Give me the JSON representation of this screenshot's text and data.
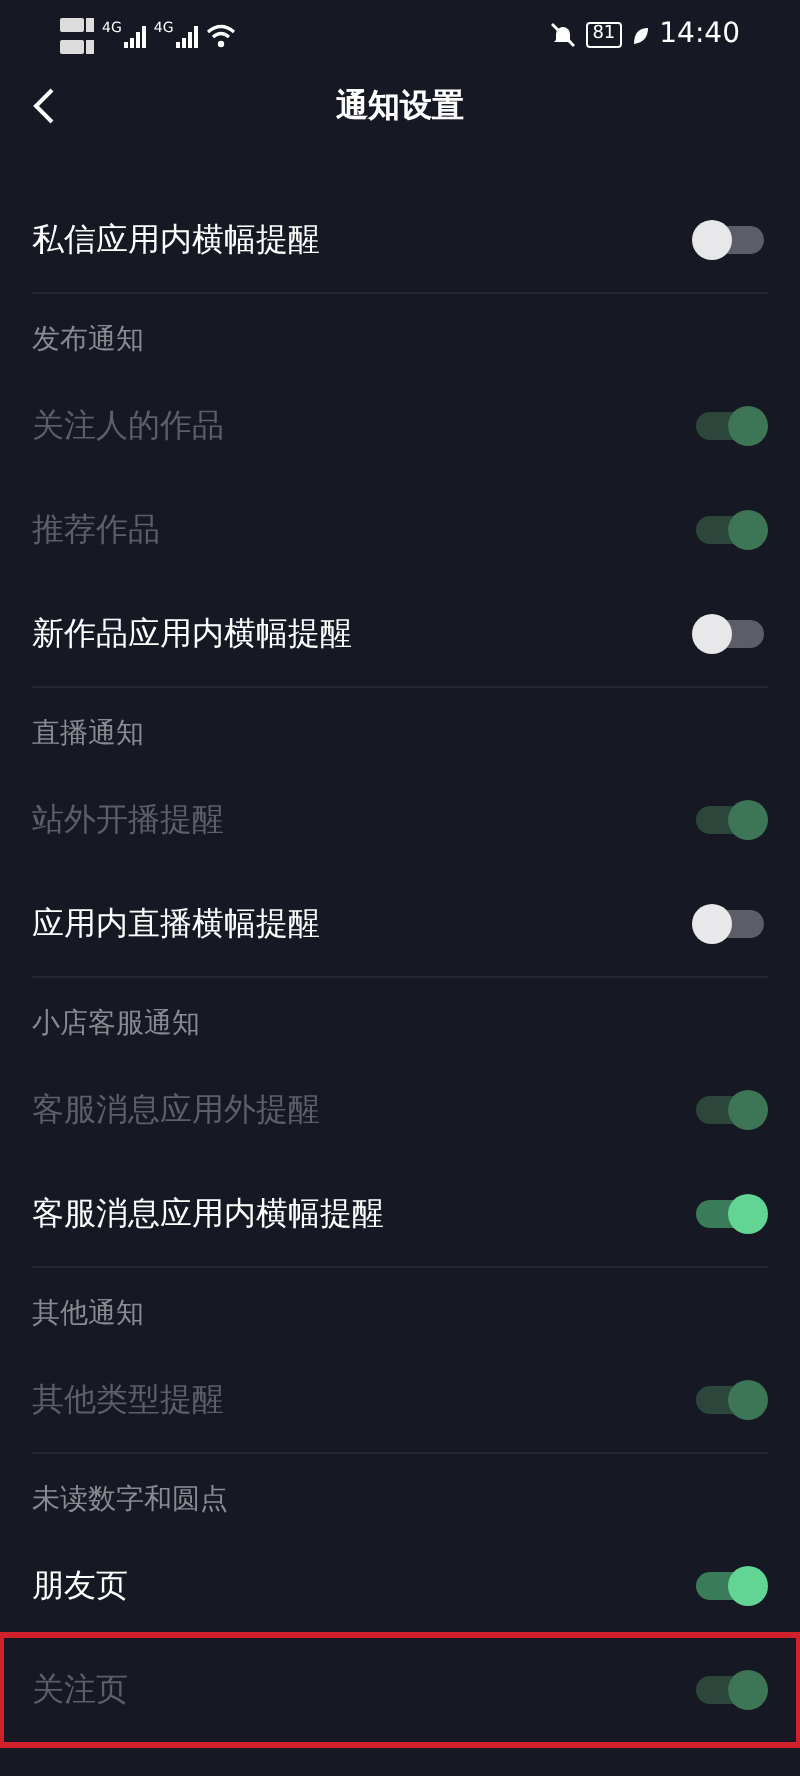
{
  "status_bar": {
    "network_1": "4G",
    "network_2": "4G",
    "battery": "81",
    "time": "14:40"
  },
  "header": {
    "title": "通知设置"
  },
  "groups": [
    {
      "items": [
        {
          "label": "私信应用内横幅提醒",
          "on": false,
          "disabled": false,
          "highlighted": false
        }
      ]
    },
    {
      "title": "发布通知",
      "items": [
        {
          "label": "关注人的作品",
          "on": true,
          "disabled": true,
          "highlighted": false
        },
        {
          "label": "推荐作品",
          "on": true,
          "disabled": true,
          "highlighted": false
        },
        {
          "label": "新作品应用内横幅提醒",
          "on": false,
          "disabled": false,
          "highlighted": false
        }
      ]
    },
    {
      "title": "直播通知",
      "items": [
        {
          "label": "站外开播提醒",
          "on": true,
          "disabled": true,
          "highlighted": false
        },
        {
          "label": "应用内直播横幅提醒",
          "on": false,
          "disabled": false,
          "highlighted": false
        }
      ]
    },
    {
      "title": "小店客服通知",
      "items": [
        {
          "label": "客服消息应用外提醒",
          "on": true,
          "disabled": true,
          "highlighted": false
        },
        {
          "label": "客服消息应用内横幅提醒",
          "on": true,
          "disabled": false,
          "highlighted": false
        }
      ]
    },
    {
      "title": "其他通知",
      "items": [
        {
          "label": "其他类型提醒",
          "on": true,
          "disabled": true,
          "highlighted": false
        }
      ]
    },
    {
      "title": "未读数字和圆点",
      "items": [
        {
          "label": "朋友页",
          "on": true,
          "disabled": false,
          "highlighted": false
        },
        {
          "label": "关注页",
          "on": true,
          "disabled": true,
          "highlighted": true
        }
      ]
    }
  ]
}
